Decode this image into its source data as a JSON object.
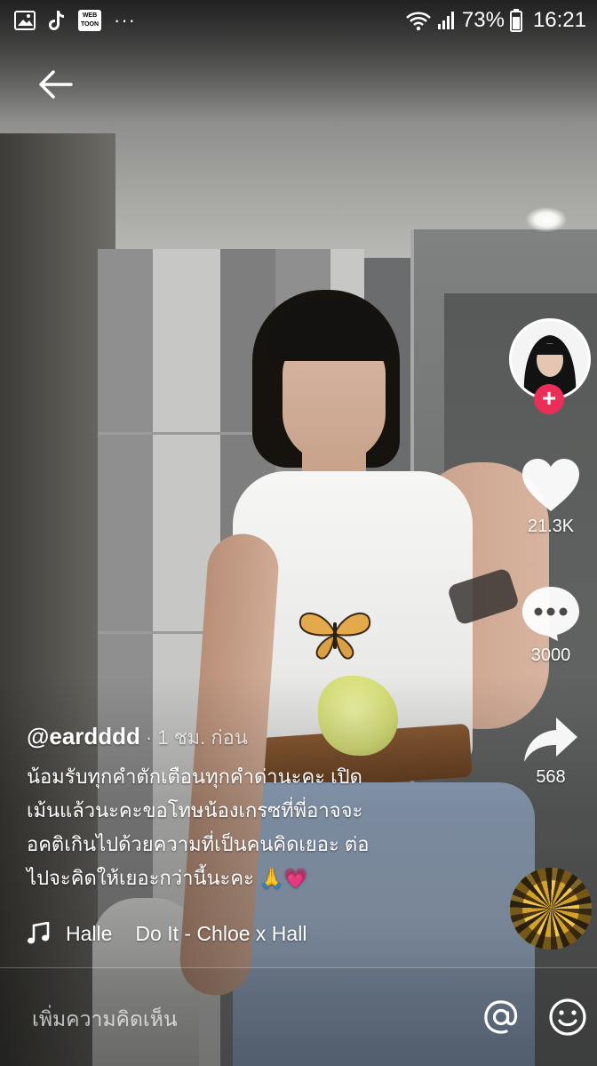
{
  "status_bar": {
    "battery_percent": "73%",
    "time": "16:21",
    "left_icons": [
      "gallery-icon",
      "tiktok-icon",
      "webtoon-icon",
      "more-notifications-icon"
    ],
    "webtoon_badge": "WEB TOON",
    "more": "···"
  },
  "header": {
    "back_icon": "arrow-left-icon"
  },
  "side_actions": {
    "avatar": "creator-avatar",
    "follow_icon": "plus-icon",
    "follow_label": "+",
    "likes": {
      "icon": "heart-icon",
      "count": "21.3K"
    },
    "comments": {
      "icon": "comment-bubble-icon",
      "count": "3000"
    },
    "shares": {
      "icon": "share-arrow-icon",
      "count": "568"
    },
    "music_disc": "music-disc-icon"
  },
  "post": {
    "username": "@eardddd",
    "time_ago": "· 1 ชม. ก่อน",
    "caption": "น้อมรับทุกคำตักเตือนทุกคำด่านะคะ เปิด\nเม้นแล้วนะคะขอโทษน้องเกรซที่พี่อาจจะ\nอคติเกินไปด้วยความที่เป็นคนคิดเยอะ ต่อ\nไปจะคิดให้เยอะกว่านี้นะคะ",
    "caption_emojis": "🙏💗",
    "music_icon": "music-note-icon",
    "music_fragment": "Halle",
    "music_title": "Do It - Chloe x Hall"
  },
  "comment_bar": {
    "placeholder": "เพิ่มความคิดเห็น",
    "mention_icon": "at-sign-icon",
    "emoji_icon": "emoji-smile-icon"
  },
  "colors": {
    "follow_button": "#ea2e58",
    "text": "#ffffff"
  }
}
